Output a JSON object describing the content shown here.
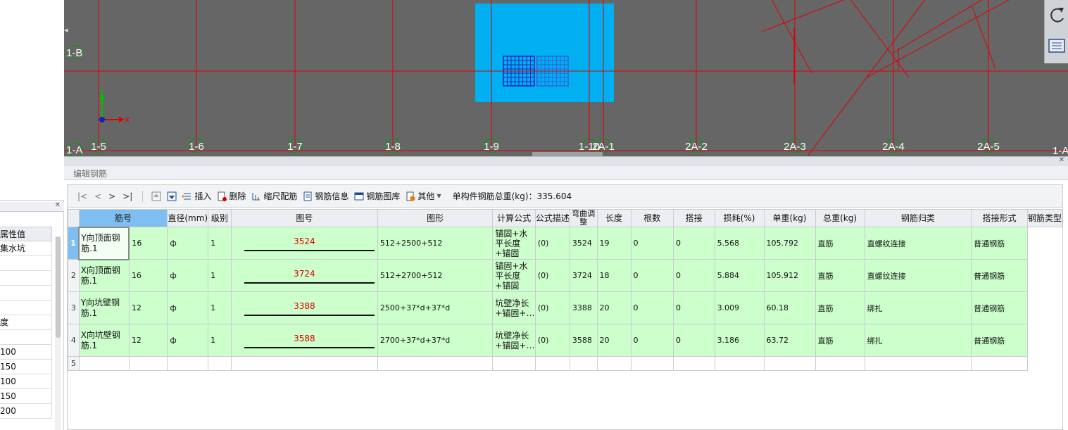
{
  "canvas": {
    "axes_v": [
      "1-5",
      "1-6",
      "1-7",
      "1-8",
      "1-9",
      "1-10",
      "2A-1",
      "2A-2",
      "2A-3",
      "2A-4",
      "2A-5"
    ],
    "axes_h_left": [
      "1-B",
      "1-A"
    ],
    "axis_h_right": "1-A",
    "coord_y": "Y",
    "coord_x": "X"
  },
  "left_panel": {
    "header": "属性值",
    "rows": [
      "集水坑",
      "",
      "",
      "",
      "",
      "度",
      "",
      "100",
      "150",
      "100",
      "150",
      "200"
    ]
  },
  "editor": {
    "title": "编辑钢筋",
    "toolbar": {
      "nav_first": "|<",
      "nav_prev": "<",
      "nav_next": ">",
      "nav_last": ">|",
      "insert": "插入",
      "delete": "删除",
      "scale": "缩尺配筋",
      "info": "钢筋信息",
      "library": "钢筋图库",
      "other": "其他",
      "total": "单构件钢筋总重(kg)：335.604"
    },
    "columns": [
      "筋号",
      "直径(mm)",
      "级别",
      "图号",
      "图形",
      "计算公式",
      "公式描述",
      "弯曲调整",
      "长度",
      "根数",
      "搭接",
      "损耗(%)",
      "单重(kg)",
      "总重(kg)",
      "钢筋归类",
      "搭接形式",
      "钢筋类型"
    ],
    "rows": [
      {
        "no": "1",
        "name": "Y向顶面钢筋.1",
        "dia": "16",
        "grade": "ф",
        "fig_no": "1",
        "shape": "3524",
        "formula": "512+2500+512",
        "desc": "锚固+水平长度+锚固",
        "bend": "(0)",
        "length": "3524",
        "count": "19",
        "lap": "0",
        "loss": "0",
        "unit_w": "5.568",
        "total_w": "105.792",
        "category": "直筋",
        "lap_type": "直螺纹连接",
        "type": "普通钢筋"
      },
      {
        "no": "2",
        "name": "X向顶面钢筋.1",
        "dia": "16",
        "grade": "ф",
        "fig_no": "1",
        "shape": "3724",
        "formula": "512+2700+512",
        "desc": "锚固+水平长度+锚固",
        "bend": "(0)",
        "length": "3724",
        "count": "18",
        "lap": "0",
        "loss": "0",
        "unit_w": "5.884",
        "total_w": "105.912",
        "category": "直筋",
        "lap_type": "直螺纹连接",
        "type": "普通钢筋"
      },
      {
        "no": "3",
        "name": "Y向坑壁钢筋.1",
        "dia": "12",
        "grade": "ф",
        "fig_no": "1",
        "shape": "3388",
        "formula": "2500+37*d+37*d",
        "desc": "坑壁净长+锚固+…",
        "bend": "(0)",
        "length": "3388",
        "count": "20",
        "lap": "0",
        "loss": "0",
        "unit_w": "3.009",
        "total_w": "60.18",
        "category": "直筋",
        "lap_type": "绑扎",
        "type": "普通钢筋"
      },
      {
        "no": "4",
        "name": "X向坑壁钢筋.1",
        "dia": "12",
        "grade": "ф",
        "fig_no": "1",
        "shape": "3588",
        "formula": "2700+37*d+37*d",
        "desc": "坑壁净长+锚固+…",
        "bend": "(0)",
        "length": "3588",
        "count": "20",
        "lap": "0",
        "loss": "0",
        "unit_w": "3.186",
        "total_w": "63.72",
        "category": "直筋",
        "lap_type": "绑扎",
        "type": "普通钢筋"
      }
    ],
    "empty_row_no": "5"
  }
}
